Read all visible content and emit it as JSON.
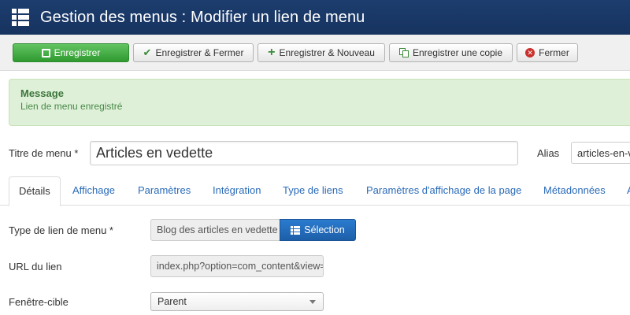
{
  "header": {
    "title": "Gestion des menus : Modifier un lien de menu",
    "icon": "menu-list-icon"
  },
  "toolbar": {
    "save": "Enregistrer",
    "save_close": "Enregistrer & Fermer",
    "save_new": "Enregistrer & Nouveau",
    "save_copy": "Enregistrer une copie",
    "close": "Fermer"
  },
  "message": {
    "heading": "Message",
    "text": "Lien de menu enregistré"
  },
  "form": {
    "title_label": "Titre de menu *",
    "title_value": "Articles en vedette",
    "alias_label": "Alias",
    "alias_value": "articles-en-vedette",
    "type_label": "Type de lien de menu *",
    "type_value": "Blog des articles en vedette",
    "select_button": "Sélection",
    "url_label": "URL du lien",
    "url_value": "index.php?option=com_content&view=featured",
    "target_label": "Fenêtre-cible",
    "target_value": "Parent"
  },
  "tabs": [
    {
      "label": "Détails",
      "active": true
    },
    {
      "label": "Affichage"
    },
    {
      "label": "Paramètres"
    },
    {
      "label": "Intégration"
    },
    {
      "label": "Type de liens"
    },
    {
      "label": "Paramètres d'affichage de la page"
    },
    {
      "label": "Métadonnées"
    },
    {
      "label": "A"
    }
  ],
  "colors": {
    "header_bg": "#1a3867",
    "success": "#46a546",
    "primary": "#2a6ab8",
    "message_bg": "#dff0d8"
  }
}
